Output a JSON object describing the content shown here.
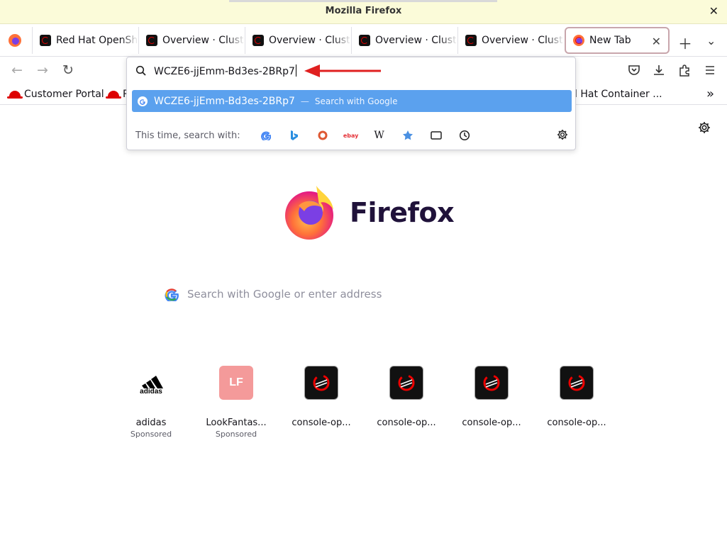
{
  "window": {
    "title": "Mozilla Firefox"
  },
  "tabs": [
    {
      "title": "Red Hat OpenShift",
      "active": false
    },
    {
      "title": "Overview · Clusters",
      "active": false
    },
    {
      "title": "Overview · Clusters",
      "active": false
    },
    {
      "title": "Overview · Clusters",
      "active": false
    },
    {
      "title": "Overview · Clusters",
      "active": false
    },
    {
      "title": "New Tab",
      "active": true
    }
  ],
  "bookmarks": [
    {
      "label": "Customer Portal"
    },
    {
      "label": "R"
    },
    {
      "label": "l Hat Container ..."
    }
  ],
  "urlbar": {
    "value": "WCZE6-jjEmm-Bd3es-2BRp7",
    "suggestion_text": "WCZE6-jjEmm-Bd3es-2BRp7",
    "suggestion_dash": "—",
    "suggestion_action": "Search with Google",
    "one_off_label": "This time, search with:",
    "engines": [
      "google-icon",
      "bing-icon",
      "duckduckgo-icon",
      "ebay-icon",
      "wikipedia-icon",
      "bookmarks-icon",
      "tabs-icon",
      "history-icon"
    ],
    "ebay_text": "ebay",
    "wiki_text": "W"
  },
  "newtab": {
    "logo_text": "Firefox",
    "search_placeholder": "Search with Google or enter address",
    "top_sites": [
      {
        "name": "adidas",
        "sponsored": "Sponsored",
        "icon": "adidas-icon"
      },
      {
        "name": "LookFantas...",
        "sponsored": "Sponsored",
        "icon_text": "LF"
      },
      {
        "name": "console-op...",
        "sponsored": "",
        "icon": "openshift-icon"
      },
      {
        "name": "console-op...",
        "sponsored": "",
        "icon": "openshift-icon"
      },
      {
        "name": "console-op...",
        "sponsored": "",
        "icon": "openshift-icon"
      },
      {
        "name": "console-op...",
        "sponsored": "",
        "icon": "openshift-icon"
      }
    ],
    "adidas_text": "adidas"
  },
  "colors": {
    "accent": "#5ba1ee",
    "arrow": "#e02020",
    "titlebar": "#fbfbd9"
  }
}
